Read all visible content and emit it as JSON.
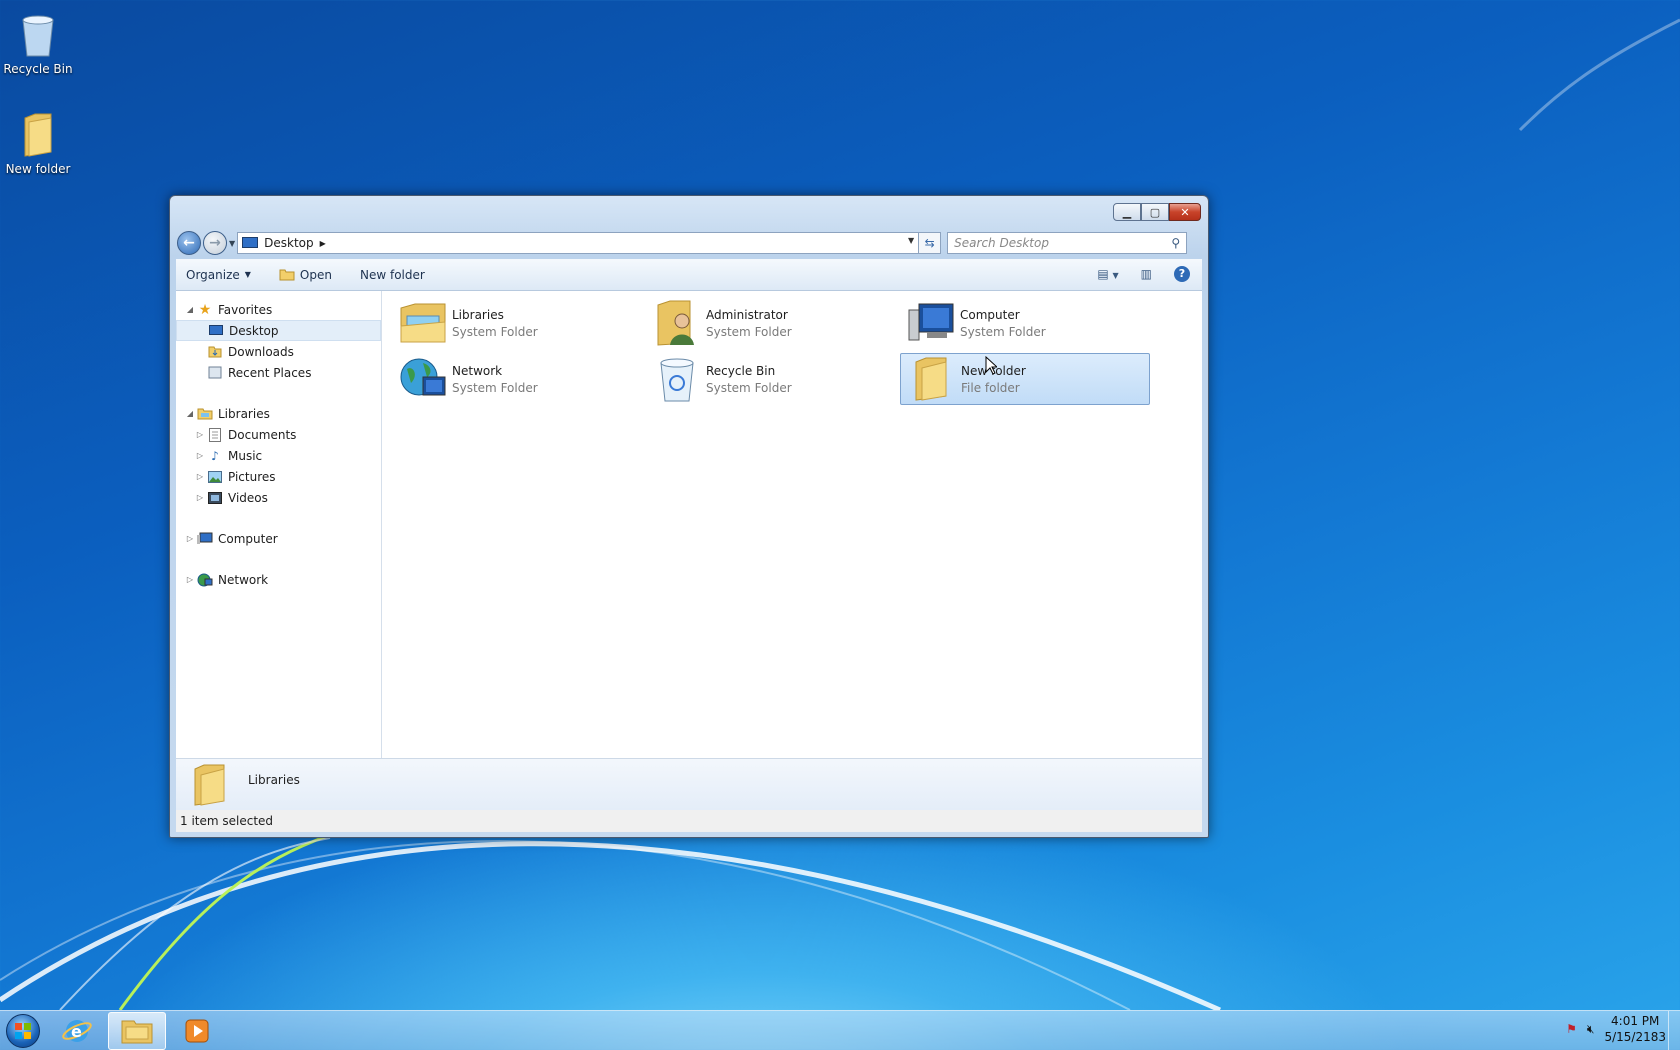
{
  "desktop": {
    "icons": [
      {
        "label": "Recycle Bin",
        "icon": "recycle-bin-icon"
      },
      {
        "label": "New folder",
        "icon": "folder-icon"
      }
    ]
  },
  "window": {
    "address": {
      "location": "Desktop"
    },
    "search": {
      "placeholder": "Search Desktop"
    },
    "toolbar": {
      "organize": "Organize",
      "open": "Open",
      "new_folder": "New folder"
    },
    "nav": {
      "favorites": "Favorites",
      "desktop": "Desktop",
      "downloads": "Downloads",
      "recent_places": "Recent Places",
      "libraries": "Libraries",
      "documents": "Documents",
      "music": "Music",
      "pictures": "Pictures",
      "videos": "Videos",
      "computer": "Computer",
      "network": "Network"
    },
    "items": [
      {
        "name": "Libraries",
        "type": "System Folder",
        "icon": "libraries-icon"
      },
      {
        "name": "Administrator",
        "type": "System Folder",
        "icon": "user-folder-icon"
      },
      {
        "name": "Computer",
        "type": "System Folder",
        "icon": "computer-icon"
      },
      {
        "name": "Network",
        "type": "System Folder",
        "icon": "network-icon"
      },
      {
        "name": "Recycle Bin",
        "type": "System Folder",
        "icon": "recycle-bin-icon"
      },
      {
        "name": "New folder",
        "type": "File folder",
        "icon": "folder-icon",
        "selected": true
      }
    ],
    "details": {
      "name": "Libraries"
    },
    "status": "1 item selected"
  },
  "taskbar": {
    "clock": {
      "time": "4:01 PM",
      "date": "5/15/2183"
    }
  },
  "colors": {
    "selection": "#c1dcf7",
    "accent": "#1378d3"
  }
}
